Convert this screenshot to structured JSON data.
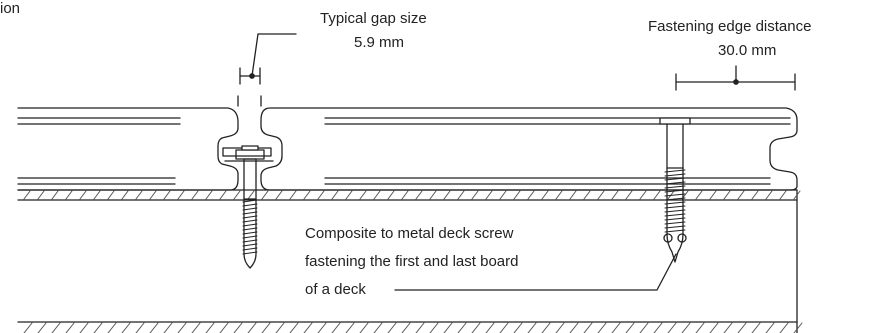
{
  "fragment_label": "ion",
  "gap": {
    "title": "Typical gap size",
    "value": "5.9 mm"
  },
  "edge": {
    "title": "Fastening edge distance",
    "value": "30.0 mm"
  },
  "screw_note": {
    "line1": "Composite to metal deck screw",
    "line2": "fastening the first and last board",
    "line3": "of a deck"
  },
  "colors": {
    "line": "#222222",
    "hatch": "#555555",
    "background": "#ffffff"
  }
}
